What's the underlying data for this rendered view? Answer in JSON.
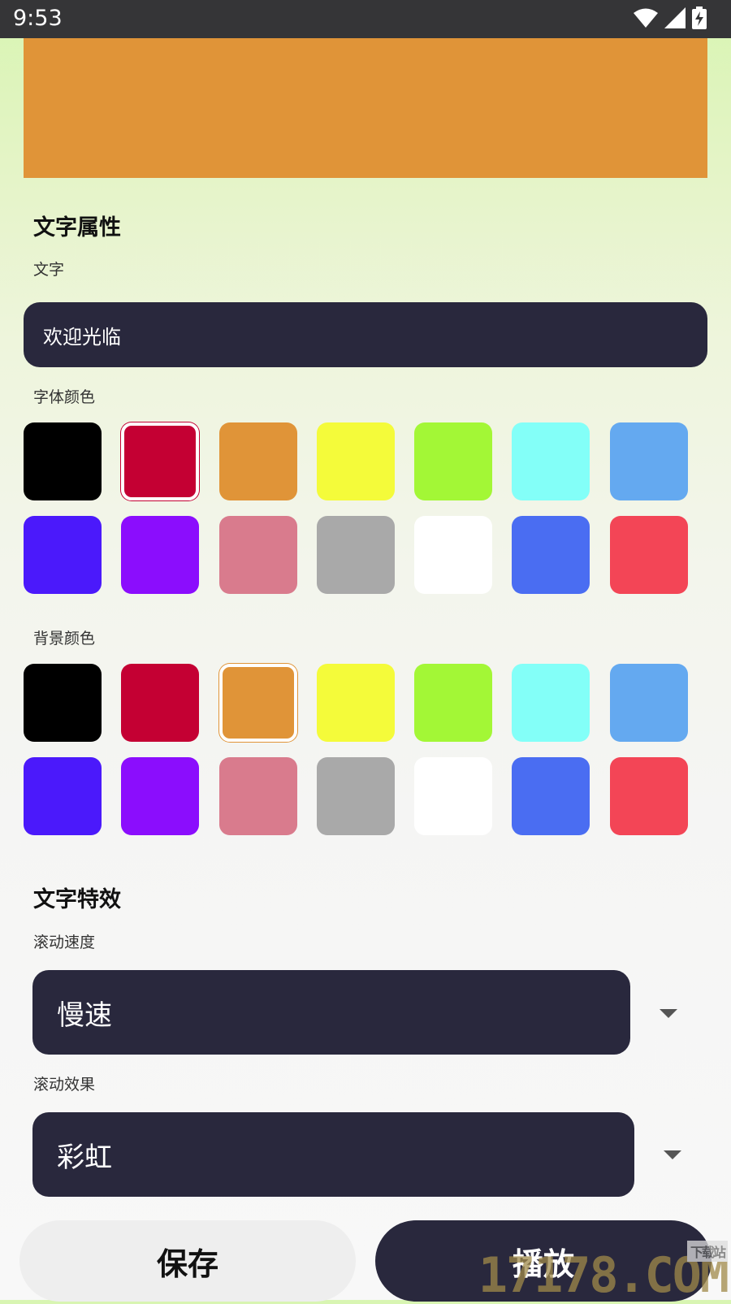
{
  "status_bar": {
    "time": "9:53"
  },
  "preview": {
    "background_color": "#e09438"
  },
  "text_props": {
    "title": "文字属性",
    "text_label": "文字",
    "text_value": "欢迎光临",
    "font_color_label": "字体颜色",
    "font_color_selected_index": 1,
    "bg_color_label": "背景颜色",
    "bg_color_selected_index": 2
  },
  "palette": [
    "#000000",
    "#c40033",
    "#e09438",
    "#f4fb3a",
    "#a3f736",
    "#83fff8",
    "#64a9f0",
    "#4b19fb",
    "#8b0dfd",
    "#d97b8d",
    "#a9a9a9",
    "#ffffff",
    "#4a6df2",
    "#f34556"
  ],
  "effects": {
    "title": "文字特效",
    "speed_label": "滚动速度",
    "speed_value": "慢速",
    "effect_label": "滚动效果",
    "effect_value": "彩虹"
  },
  "buttons": {
    "save_label": "保存",
    "play_label": "播放"
  },
  "watermark": {
    "text": "17178.COM",
    "small": "下载站"
  }
}
